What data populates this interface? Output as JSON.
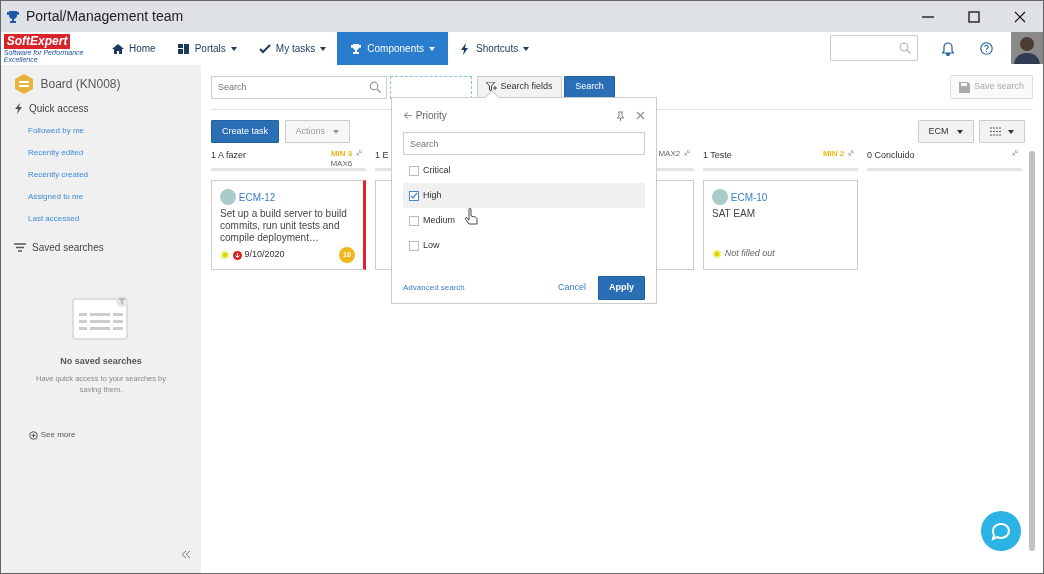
{
  "window": {
    "title": "Portal/Management team"
  },
  "nav": {
    "logo_top": "SoftExpert",
    "logo_sub": "Software for Performance Excellence",
    "items": [
      {
        "label": "Home",
        "dropdown": false,
        "selected": false
      },
      {
        "label": "Portals",
        "dropdown": true,
        "selected": false
      },
      {
        "label": "My tasks",
        "dropdown": true,
        "selected": false
      },
      {
        "label": "Components",
        "dropdown": true,
        "selected": true
      },
      {
        "label": "Shortcuts",
        "dropdown": true,
        "selected": false
      }
    ]
  },
  "sidebar": {
    "title": "Board (KN008)",
    "quick_access": "Quick access",
    "links": [
      "Followed by me",
      "Recently edited",
      "Recently created",
      "Assigned to me",
      "Last accessed"
    ],
    "saved_searches": "Saved searches",
    "empty_title": "No saved searches",
    "empty_text": "Have quick access to your searches by saving them.",
    "see_more": "See more"
  },
  "toolbar": {
    "search_placeholder": "Search",
    "search_fields": "Search fields",
    "search": "Search",
    "save_search": "Save search",
    "create_task": "Create task",
    "actions": "Actions",
    "ecm": "ECM"
  },
  "columns": [
    {
      "kind": "open",
      "title": "1 A fazer",
      "min": "MIN 3",
      "max": "MAX6",
      "cards": [
        {
          "id": "ECM-12",
          "text": "Set up a build server to build commits, run unit tests and compile deployment…",
          "date": "9/10/2020",
          "overdue": true,
          "badge": "10",
          "color": "#e8202e"
        }
      ]
    },
    {
      "kind": "covered",
      "title": "1 E"
    },
    {
      "kind": "covered",
      "max": "MAX2"
    },
    {
      "kind": "open",
      "title": "1 Teste",
      "min": "MIN 2",
      "cards": [
        {
          "id": "ECM-10",
          "text": "SAT EAM",
          "status": "Not filled out"
        }
      ]
    },
    {
      "kind": "open",
      "title": "0 Concluido"
    }
  ],
  "popover": {
    "title": "Priority",
    "search_placeholder": "Search",
    "options": [
      {
        "label": "Critical",
        "checked": false,
        "highlighted": false
      },
      {
        "label": "High",
        "checked": true,
        "highlighted": true
      },
      {
        "label": "Medium",
        "checked": false,
        "highlighted": false
      },
      {
        "label": "Low",
        "checked": false,
        "highlighted": false
      }
    ],
    "advanced": "Advanced search",
    "cancel": "Cancel",
    "apply": "Apply"
  }
}
